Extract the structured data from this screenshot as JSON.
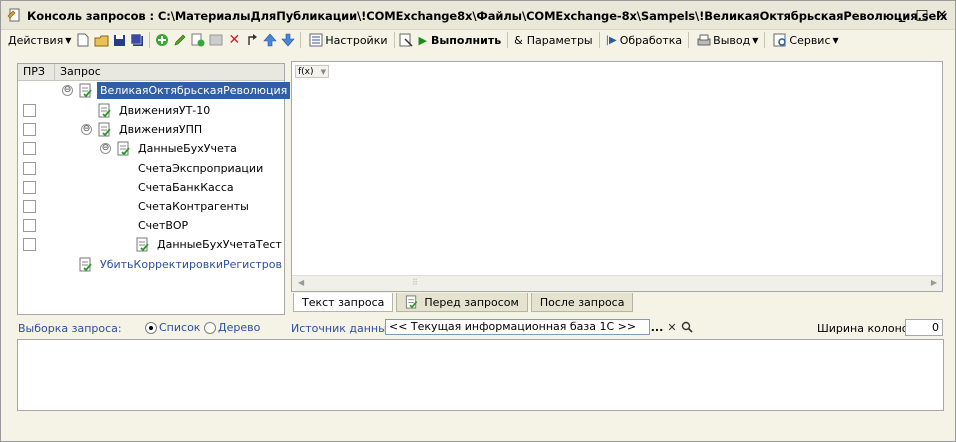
{
  "window": {
    "title": "Консоль запросов : C:\\МатериалыДляПубликации\\!COMExchange8x\\Файлы\\COMExchange-8x\\Sampels\\!ВеликаяОктябрьскаяРеволюция.selx",
    "minimize_glyph": "_",
    "maximize_glyph": "□",
    "close_glyph": "✕"
  },
  "toolbar": {
    "actions_label": "Действия",
    "settings_label": "Настройки",
    "run_label": "Выполнить",
    "params_label": "Параметры",
    "processing_label": "Обработка",
    "output_label": "Вывод",
    "service_label": "Сервис"
  },
  "tree": {
    "col_prz": "ПРЗ",
    "col_query": "Запрос",
    "items": [
      {
        "label": "ВеликаяОктябрьскаяРеволюция",
        "toggle": "⊖"
      },
      {
        "label": "ДвиженияУТ-10"
      },
      {
        "label": "ДвиженияУПП",
        "toggle": "⊖"
      },
      {
        "label": "ДанныеБухУчета",
        "toggle": "⊖"
      },
      {
        "label": "СчетаЭкспроприации"
      },
      {
        "label": "СчетаБанкКасса"
      },
      {
        "label": "СчетаКонтрагенты"
      },
      {
        "label": "СчетВОР"
      },
      {
        "label": "ДанныеБухУчетаТест"
      },
      {
        "label": "УбитьКорректировкиРегистров"
      }
    ]
  },
  "editor": {
    "fx_label": "f(x)"
  },
  "tabs": [
    {
      "label": "Текст запроса"
    },
    {
      "label": "Перед запросом"
    },
    {
      "label": "После запроса"
    }
  ],
  "bottom": {
    "selection_label": "Выборка запроса:",
    "list_label": "Список",
    "tree_label": "Дерево",
    "source_label": "Источник данных:",
    "source_value": "<< Текущая информационная база 1С >>",
    "col_width_label": "Ширина колонок:",
    "col_width_value": "0"
  },
  "colors": {
    "selected_row_bg": "#2f5fa6",
    "link_blue": "#2c4ea0",
    "run_green": "#1a8c1a"
  }
}
